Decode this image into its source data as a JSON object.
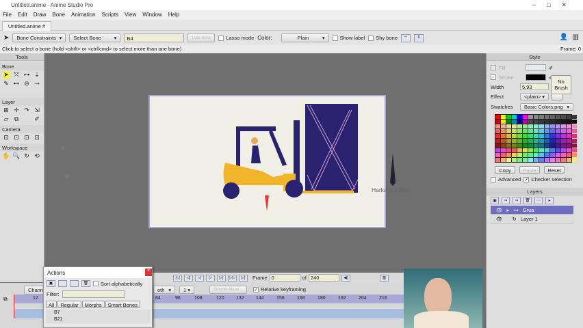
{
  "window": {
    "title": "Untitled.anime - Anime Studio Pro"
  },
  "menu": [
    "File",
    "Edit",
    "Draw",
    "Bone",
    "Animation",
    "Scripts",
    "View",
    "Window",
    "Help"
  ],
  "document_tab": "Untitled.anime #",
  "toolbar": {
    "bone_constraints": "Bone Constraints",
    "select_bone": "Select Bone",
    "bone_name": "B4",
    "lock_bone": "Lock bone",
    "lasso_mode": "Lasso mode",
    "color_label": "Color:",
    "color_value": "Plain",
    "show_label": "Show label",
    "shy_bone": "Shy bone"
  },
  "status": {
    "message": "Click to select a bone (hold <shift> or <ctrl/cmd> to select more than one bone)",
    "frame": "Frame: 0"
  },
  "tools": {
    "title": "Tools",
    "sections": [
      "Bone",
      "Layer",
      "Camera",
      "Workspace"
    ]
  },
  "canvas": {
    "label": "Harkat e Liftno"
  },
  "style": {
    "title": "Style",
    "fill": "Fill",
    "stroke": "Stroke",
    "width_label": "Width",
    "width_value": "5.93",
    "no_brush": "No Brush",
    "effect_label": "Effect",
    "effect_value": "<plain>",
    "swatches_label": "Swatches",
    "swatches_value": "Basic Colors.png",
    "copy": "Copy",
    "paste": "Paste",
    "reset": "Reset",
    "advanced": "Advanced",
    "checker": "Checker selection"
  },
  "layers": {
    "title": "Layers",
    "items": [
      {
        "name": "Grua",
        "selected": true
      },
      {
        "name": "Layer 1",
        "selected": false
      }
    ]
  },
  "timeline": {
    "frame_label": "Frame",
    "frame_value": "0",
    "of_label": "of",
    "total": "240",
    "channels_tab": "Chann",
    "smooth": "oth",
    "step": "1",
    "smooth_menu": "Smooth Menu",
    "relative_keyframing": "Relative keyframing",
    "ticks": [
      "12",
      "84",
      "96",
      "108",
      "120",
      "132",
      "144",
      "156",
      "168",
      "180",
      "192",
      "204",
      "216"
    ]
  },
  "actions": {
    "title": "Actions",
    "sort": "Sort alphabetically",
    "filter_label": "Filter:",
    "tabs": [
      "All",
      "Regular",
      "Morphs",
      "Smart Bones"
    ],
    "items": [
      "B7",
      "B21"
    ]
  },
  "colors": {
    "accent": "#a9a8d6",
    "box": "#2a2270",
    "forklift": "#f1b52a"
  }
}
